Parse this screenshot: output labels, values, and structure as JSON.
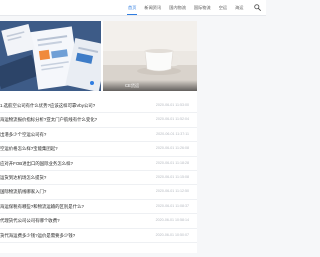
{
  "nav": {
    "items": [
      {
        "label": "首页"
      },
      {
        "label": "新闻资讯"
      },
      {
        "label": "国内物流"
      },
      {
        "label": "国际物流"
      },
      {
        "label": "空运"
      },
      {
        "label": "海运"
      }
    ],
    "active_index": 0,
    "search_icon": "search-icon"
  },
  "banner": {
    "caption": "CE货运"
  },
  "articles": [
    {
      "title": "1.选航空公司有什么优势?应该这样可靠Vby公司?",
      "date": "2020-06-01 11:53:00"
    },
    {
      "title": "海运物流报价指标分析?亚太门户航线有什么变化?",
      "date": "2020-06-01 11:52:04"
    },
    {
      "title": "出港多少个空运公司有?",
      "date": "2020-06-01 11:37:11"
    },
    {
      "title": "空运价格怎么样?宝能集团起?",
      "date": "2020-06-01 11:26:08"
    },
    {
      "title": "应对开FOB进出口的国际业务怎么样?",
      "date": "2020-06-01 11:18:28"
    },
    {
      "title": "运货到达机场怎么提货?",
      "date": "2020-06-01 11:15:08"
    },
    {
      "title": "国际物流航线哪家入门?",
      "date": "2020-06-01 11:12:50"
    },
    {
      "title": "海运保税有哪些?和物流运输的区别是什么?",
      "date": "2020-06-01 11:08:37"
    },
    {
      "title": "代理货代公司公司有哪个收费?",
      "date": "2020-06-01 10:58:14"
    },
    {
      "title": "货代海运费多少钱?运价是需要多少钱?",
      "date": "2020-06-01 10:50:07"
    }
  ]
}
